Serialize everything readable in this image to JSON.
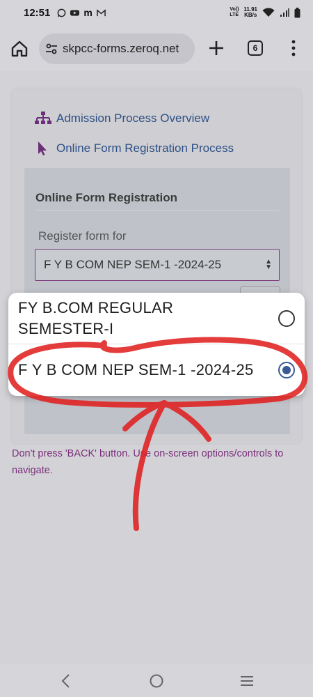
{
  "status": {
    "time": "12:51",
    "network_label_top": "Vo))",
    "network_label_bottom": "LTE",
    "speed_value": "11.91",
    "speed_unit": "KB/s",
    "notif_icons": [
      "whatsapp-icon",
      "youtube-icon",
      "m-app-icon",
      "gmail-icon"
    ],
    "status_icons": [
      "wifi-icon",
      "signal-icon",
      "battery-icon"
    ]
  },
  "browser": {
    "url": "skpcc-forms.zeroq.net",
    "tab_count": "6"
  },
  "page": {
    "links": [
      {
        "label": "Admission Process Overview",
        "icon": "sitemap-icon"
      },
      {
        "label": "Online Form Registration Process",
        "icon": "cursor-pointer-icon"
      }
    ],
    "panel_title": "Online Form Registration",
    "register_label": "Register form for",
    "selected_value": "F Y B COM NEP SEM-1 -2024-25",
    "warning": "Don't press 'BACK' button. Use on-screen options/controls to navigate."
  },
  "dropdown": {
    "options": [
      {
        "label_line1": "FY B.COM REGULAR",
        "label_line2": "SEMESTER-I",
        "selected": false
      },
      {
        "label_line1": "F Y B COM NEP SEM-1 -2024-25",
        "selected": true
      }
    ]
  },
  "colors": {
    "link": "#2d4f86",
    "warning": "#7a2f7a",
    "radio_selected": "#3a5a94",
    "annotation": "#e02020"
  }
}
